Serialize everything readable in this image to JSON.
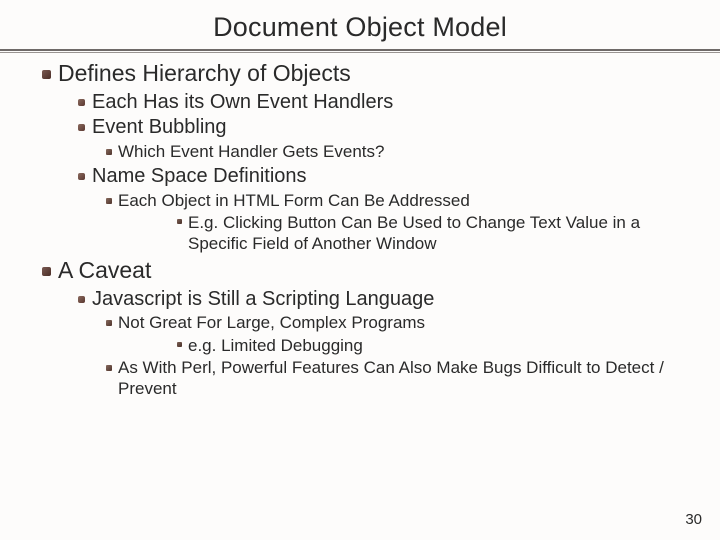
{
  "title": "Document Object Model",
  "items": {
    "i1": "Defines Hierarchy of Objects",
    "i1a": "Each Has its Own Event Handlers",
    "i1b": "Event Bubbling",
    "i1b1": "Which Event Handler Gets Events?",
    "i1c": "Name Space Definitions",
    "i1c1": "Each Object in HTML Form Can Be Addressed",
    "i1c1a": "E.g. Clicking Button Can Be Used to Change Text Value in a Specific Field of Another Window",
    "i2": "A Caveat",
    "i2a": "Javascript is Still a Scripting Language",
    "i2a1": "Not Great For Large, Complex Programs",
    "i2a1a": "e.g. Limited Debugging",
    "i2a2": "As With Perl, Powerful Features Can Also Make Bugs Difficult to Detect / Prevent"
  },
  "page_number": "30"
}
